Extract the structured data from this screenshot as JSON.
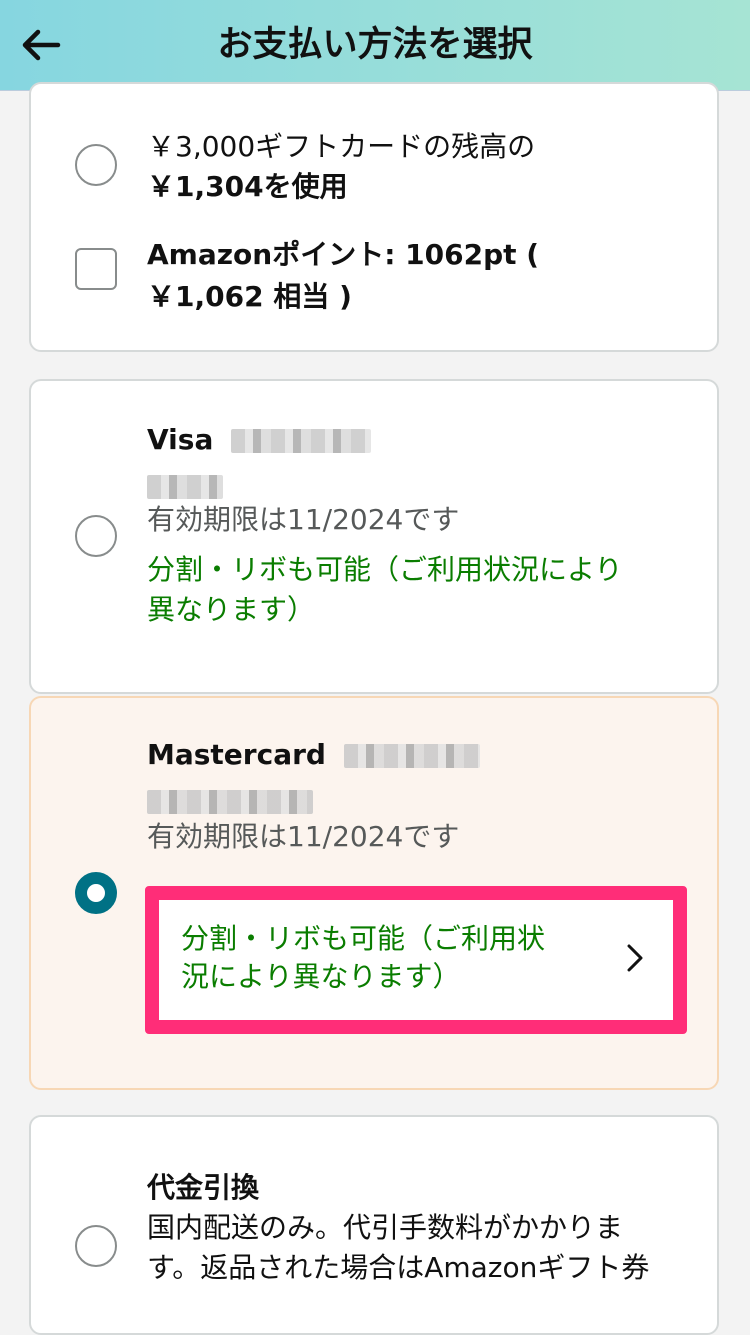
{
  "header": {
    "title": "お支払い方法を選択"
  },
  "gift_card": {
    "line1": "￥3,000ギフトカードの残高の",
    "line2": "￥1,304を使用"
  },
  "points": {
    "line1": "Amazonポイント: 1062pt (",
    "line2": "￥1,062 相当 )"
  },
  "visa": {
    "brand": "Visa",
    "expiry": "有効期限は11/2024です",
    "installment_line1": "分割・リボも可能（ご利用状況により",
    "installment_line2": "異なります）"
  },
  "mastercard": {
    "brand": "Mastercard",
    "expiry": "有効期限は11/2024です",
    "installment_line1": "分割・リボも可能（ご利用状",
    "installment_line2": "況により異なります）"
  },
  "cod": {
    "title": "代金引換",
    "desc_line1": "国内配送のみ。代引手数料がかかりま",
    "desc_line2": "す。返品された場合はAmazonギフト券"
  },
  "colors": {
    "accent": "#007185",
    "highlight": "#ff2d78",
    "green_text": "#0a7d00"
  },
  "icons": {
    "back": "arrow-left-icon",
    "chevron": "chevron-right-icon"
  }
}
